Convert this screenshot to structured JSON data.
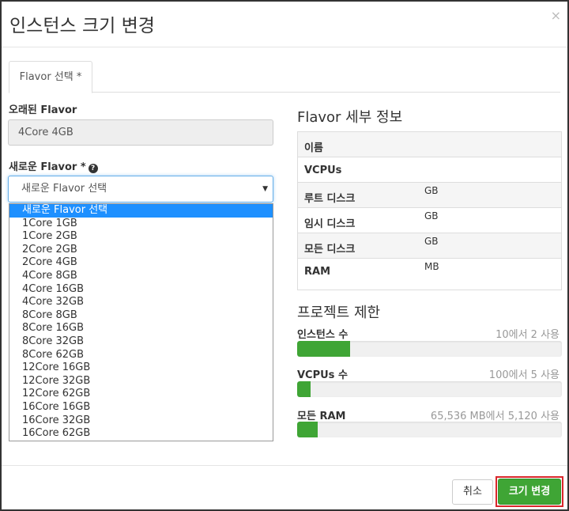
{
  "modal": {
    "title": "인스턴스 크기 변경",
    "close": "×"
  },
  "tabs": [
    {
      "label": "Flavor 선택 *"
    }
  ],
  "left": {
    "old_flavor_label": "오래된 Flavor",
    "old_flavor_value": "4Core 4GB",
    "new_flavor_label": "새로운 Flavor *",
    "help_icon": "?",
    "select_value": "새로운 Flavor 선택",
    "options": [
      "새로운 Flavor 선택",
      "1Core 1GB",
      "1Core 2GB",
      "2Core 2GB",
      "2Core 4GB",
      "4Core 8GB",
      "4Core 16GB",
      "4Core 32GB",
      "8Core 8GB",
      "8Core 16GB",
      "8Core 32GB",
      "8Core 62GB",
      "12Core 16GB",
      "12Core 32GB",
      "12Core 62GB",
      "16Core 16GB",
      "16Core 32GB",
      "16Core 62GB"
    ]
  },
  "details": {
    "title": "Flavor 세부 정보",
    "rows": [
      {
        "key": "이름",
        "unit": ""
      },
      {
        "key": "VCPUs",
        "unit": ""
      },
      {
        "key": "루트 디스크",
        "unit": "GB"
      },
      {
        "key": "임시 디스크",
        "unit": "GB"
      },
      {
        "key": "모든 디스크",
        "unit": "GB"
      },
      {
        "key": "RAM",
        "unit": "MB"
      }
    ]
  },
  "quota": {
    "title": "프로젝트 제한",
    "items": [
      {
        "label": "인스턴스 수",
        "value": "10에서 2 사용",
        "fraction": 0.2
      },
      {
        "label": "VCPUs 수",
        "value": "100에서 5 사용",
        "fraction": 0.05
      },
      {
        "label": "모든 RAM",
        "value": "65,536 MB에서 5,120 사용",
        "fraction": 0.078
      }
    ],
    "bar_color": "#3fa535"
  },
  "footer": {
    "cancel_label": "취소",
    "submit_label": "크기 변경"
  }
}
